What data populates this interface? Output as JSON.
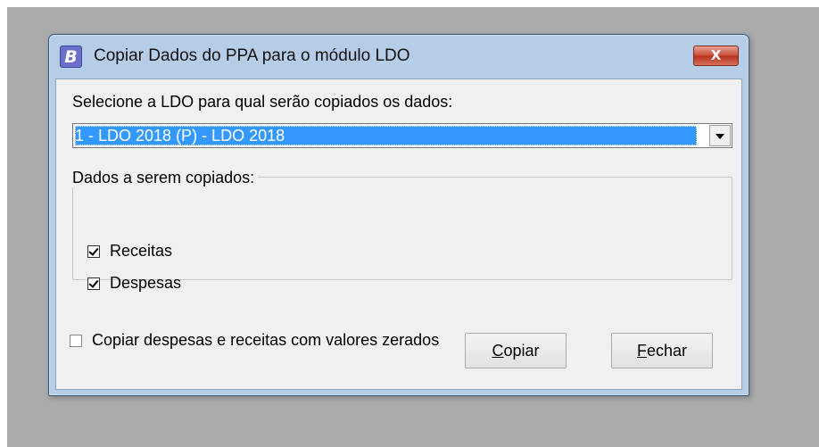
{
  "window": {
    "app_icon_letter": "B",
    "title": "Copiar Dados do PPA para o módulo LDO",
    "close_label": "X"
  },
  "form": {
    "prompt": "Selecione a LDO para qual serão copiados os dados:",
    "ldo_select": {
      "selected_value": "1 - LDO 2018 (P) - LDO 2018"
    },
    "group": {
      "legend": "Dados a serem copiados:",
      "options": [
        {
          "label": "Receitas",
          "checked": true
        },
        {
          "label": "Despesas",
          "checked": true
        }
      ]
    },
    "zero_values_option": {
      "label": "Copiar despesas e receitas com valores zerados",
      "checked": false
    }
  },
  "buttons": {
    "copy": {
      "access_key": "C",
      "rest": "opiar"
    },
    "close": {
      "access_key": "F",
      "rest": "echar"
    }
  },
  "colors": {
    "selection": "#3399ff",
    "frame": "#b5cde6",
    "close_button": "#c9503c",
    "backdrop": "#ababab"
  },
  "icons": {
    "app": "b-app-icon",
    "close": "close-icon",
    "dropdown": "chevron-down-icon",
    "check": "checkmark-icon"
  }
}
